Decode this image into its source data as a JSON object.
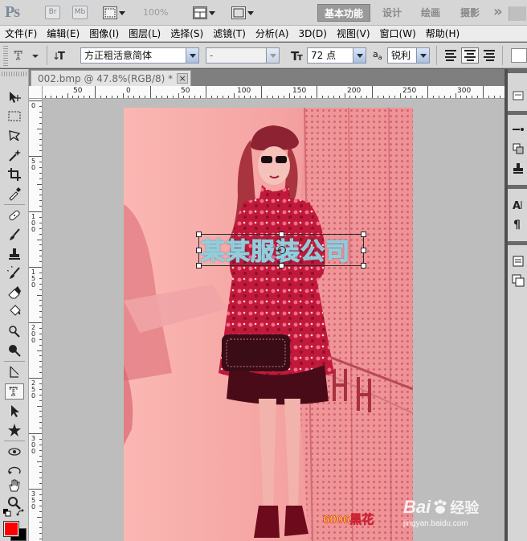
{
  "app": {
    "logo": "Ps",
    "bridge_chip": "Br",
    "minibridge_chip": "Mb",
    "zoom": "100%",
    "workspaces": [
      "基本功能",
      "设计",
      "绘画",
      "摄影"
    ],
    "more": "»"
  },
  "menu": [
    "文件(F)",
    "编辑(E)",
    "图像(I)",
    "图层(L)",
    "选择(S)",
    "滤镜(T)",
    "分析(A)",
    "3D(D)",
    "视图(V)",
    "窗口(W)",
    "帮助(H)"
  ],
  "options": {
    "font_family": "方正粗活意简体",
    "font_style": "-",
    "font_size": "72 点",
    "aa_label": "a",
    "aa_sub": "a",
    "antialias": "锐利"
  },
  "document": {
    "tab_title": "002.bmp @ 47.8%(RGB/8) *",
    "close_glyph": "×"
  },
  "rulers": {
    "h_labels": [
      "50",
      "0",
      "50",
      "100",
      "150",
      "200",
      "250",
      "300"
    ],
    "v_labels": [
      [
        "0"
      ],
      [
        "5",
        "0"
      ],
      [
        "1",
        "0",
        "0"
      ],
      [
        "1",
        "5",
        "0"
      ],
      [
        "2",
        "0",
        "0"
      ],
      [
        "2",
        "5",
        "0"
      ],
      [
        "3",
        "0",
        "0"
      ],
      [
        "3",
        "5",
        "0"
      ]
    ]
  },
  "canvas": {
    "text_layer": "某某服装公司",
    "caption": "6006黑花",
    "watermark_brand": "Bai",
    "watermark_cn": "经验",
    "watermark_url": "jingyan.baidu.com",
    "background_color": "#fbb7b3"
  },
  "colors": {
    "foreground": "#ff0000",
    "background": "#000000",
    "active_workspace": "#9a9a9a"
  }
}
